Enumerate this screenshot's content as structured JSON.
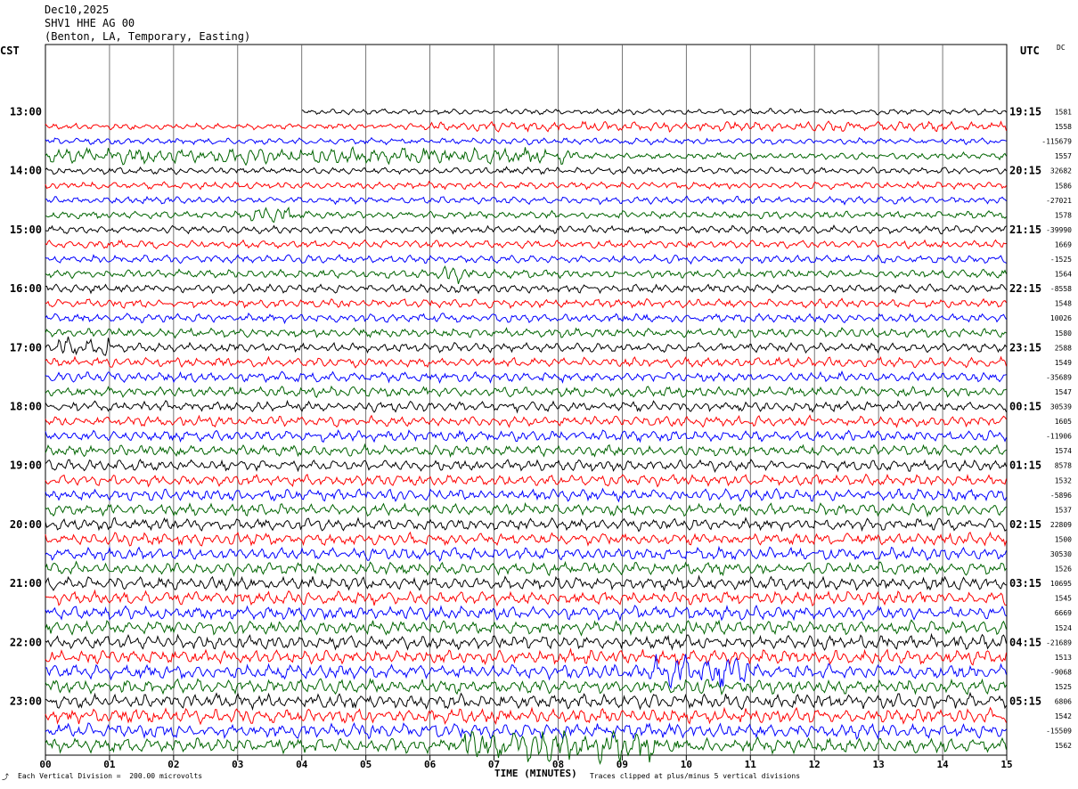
{
  "header": {
    "date": "Dec10,2025",
    "station": "SHV1 HHE AG 00",
    "location": "(Benton, LA, Temporary, Easting)"
  },
  "left_tz": "CST",
  "right_tz": "UTC",
  "dc_label": "DC",
  "footer": {
    "division": "Each Vertical Division =  200.00 microvolts",
    "clipped": "Traces clipped at plus/minus 5 vertical divisions",
    "corner": "⤴"
  },
  "colors": {
    "trace_cycle": [
      "#000000",
      "#ff0000",
      "#0000ff",
      "#006400"
    ],
    "grid": "#000000"
  },
  "chart_data": {
    "type": "line",
    "title": "SHV1 HHE AG 00",
    "xlabel": "TIME (MINUTES)",
    "ylabel": "",
    "xlim": [
      0,
      15
    ],
    "x_ticks": [
      "00",
      "01",
      "02",
      "03",
      "04",
      "05",
      "06",
      "07",
      "08",
      "09",
      "10",
      "11",
      "12",
      "13",
      "14",
      "15"
    ],
    "left_hour_labels": [
      "13:00",
      "14:00",
      "15:00",
      "16:00",
      "17:00",
      "18:00",
      "19:00",
      "20:00",
      "21:00",
      "22:00",
      "23:00"
    ],
    "right_hour_labels": [
      "19:15",
      "20:15",
      "21:15",
      "22:15",
      "23:15",
      "00:15",
      "01:15",
      "02:15",
      "03:15",
      "04:15",
      "05:15"
    ],
    "trace_minutes_per_line": 15,
    "traces_per_hour": 4,
    "trace_count": 44,
    "dc_offsets": [
      "1581",
      "1558",
      "-115679",
      "1557",
      "32682",
      "1586",
      "-27021",
      "1578",
      "-39990",
      "1669",
      "-1525",
      "1564",
      "-8558",
      "1548",
      "10026",
      "1580",
      "2588",
      "1549",
      "-35689",
      "1547",
      "30539",
      "1605",
      "-11906",
      "1574",
      "8578",
      "1532",
      "-5896",
      "1537",
      "22809",
      "1500",
      "30530",
      "1526",
      "10695",
      "1545",
      "6669",
      "1524",
      "-21689",
      "1513",
      "-9068",
      "1525",
      "6806",
      "1542",
      "-15509",
      "1562"
    ],
    "first_trace_start_minute": 4.0,
    "events": [
      {
        "trace": 1,
        "start": 5.9,
        "end": 15,
        "level": "elevated"
      },
      {
        "trace": 3,
        "start": 0,
        "end": 8.3,
        "level": "burst"
      },
      {
        "trace": 7,
        "start": 3.2,
        "end": 3.8,
        "level": "burst"
      },
      {
        "trace": 11,
        "start": 6.2,
        "end": 6.6,
        "level": "burst"
      },
      {
        "trace": 16,
        "start": 0.2,
        "end": 1.0,
        "level": "burst"
      },
      {
        "trace": 38,
        "start": 9.5,
        "end": 11.0,
        "level": "burst"
      },
      {
        "trace": 43,
        "start": 6.5,
        "end": 9.5,
        "level": "burst"
      }
    ]
  }
}
